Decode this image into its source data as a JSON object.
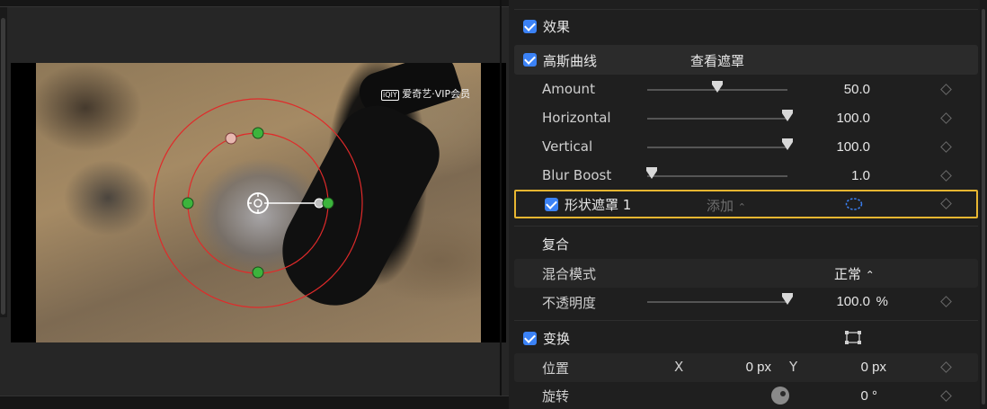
{
  "viewer": {
    "watermark": "爱奇艺·VIP会员"
  },
  "inspector": {
    "effects_section": {
      "label": "效果",
      "checked": true
    },
    "gaussian": {
      "label": "高斯曲线",
      "view_mask_label": "查看遮罩",
      "checked": true,
      "params": [
        {
          "label": "Amount",
          "value": "50.0",
          "fraction": 0.5
        },
        {
          "label": "Horizontal",
          "value": "100.0",
          "fraction": 1.0
        },
        {
          "label": "Vertical",
          "value": "100.0",
          "fraction": 1.0
        },
        {
          "label": "Blur Boost",
          "value": "1.0",
          "fraction": 0.03
        }
      ]
    },
    "shape_mask": {
      "label": "形状遮罩 1",
      "mode": "添加",
      "checked": true
    },
    "composite": {
      "label": "复合",
      "blend_mode_label": "混合模式",
      "blend_mode_value": "正常",
      "opacity_label": "不透明度",
      "opacity_value": "100.0",
      "opacity_unit": "%",
      "opacity_fraction": 1.0
    },
    "transform": {
      "label": "变换",
      "checked": true,
      "position_label": "位置",
      "x_label": "X",
      "x_value": "0 px",
      "y_label": "Y",
      "y_value": "0 px",
      "rotation_label": "旋转",
      "rotation_value": "0 °"
    }
  },
  "colors": {
    "accent": "#3b82f6",
    "highlight_border": "#e8b631",
    "handle_green": "#3cb43c",
    "mask_ring": "#e02a2a"
  }
}
